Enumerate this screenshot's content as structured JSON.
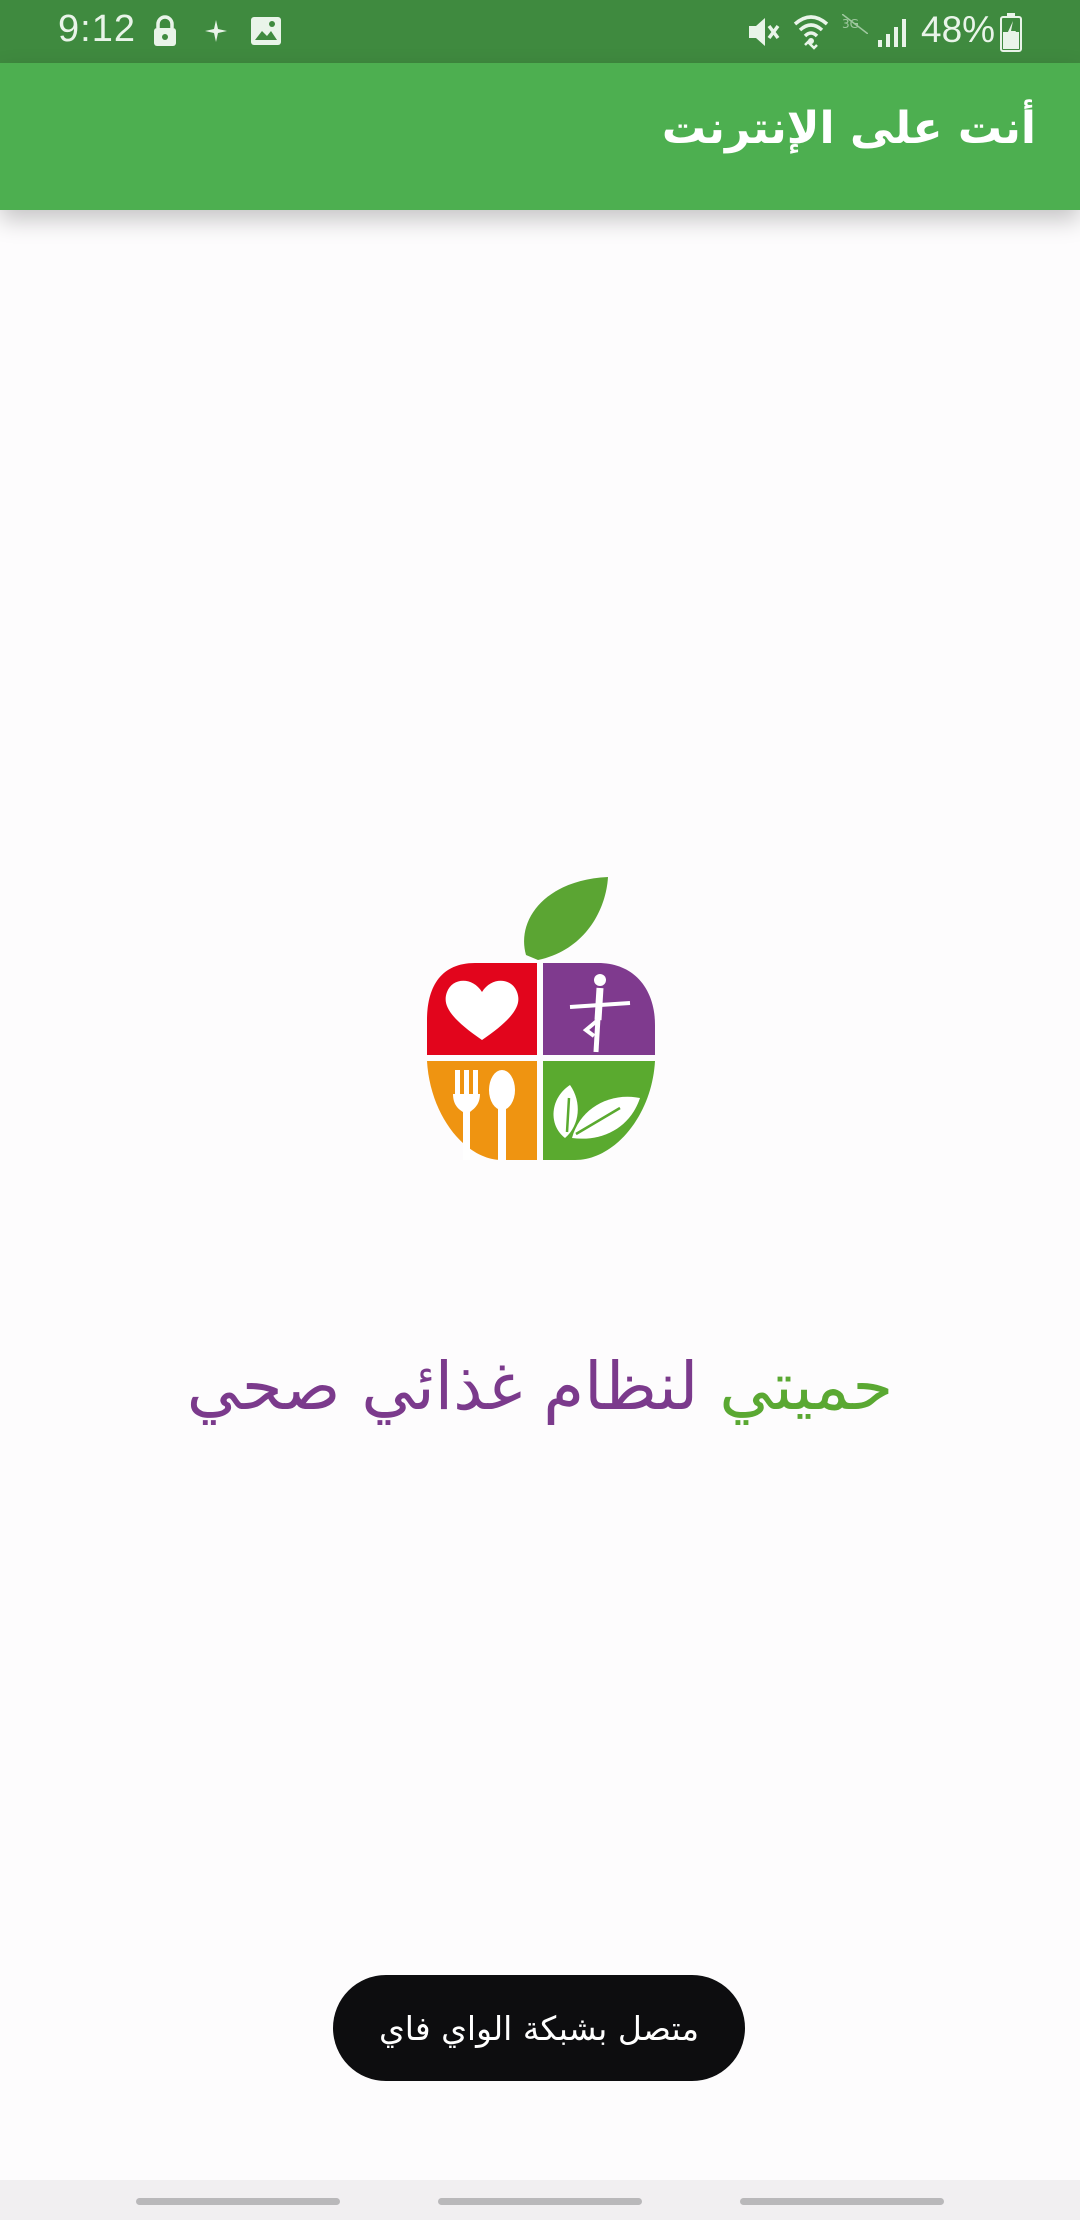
{
  "status_bar": {
    "time": "9:12",
    "battery": "48%",
    "icons": [
      "lock-icon",
      "sparkle-icon",
      "image-icon",
      "mute-icon",
      "wifi-icon",
      "signal-icon",
      "battery-icon"
    ]
  },
  "app_bar": {
    "title": "أنت على الإنترنت"
  },
  "logo": {
    "icon": "apple-logo-icon",
    "colors": {
      "leaf": "#5ba533",
      "heart_quadrant": "#e2051c",
      "figure_quadrant": "#7f3a8e",
      "cutlery_quadrant": "#ef9411",
      "leaves_quadrant": "#5aaa2f"
    }
  },
  "slogan": {
    "part1": "حميتي",
    "part2": "لنظام غذائي صحي",
    "colors": {
      "part1": "#5aa832",
      "part2": "#7b3a8c"
    }
  },
  "toast": {
    "message": "متصل بشبكة الواي فاي"
  },
  "colors": {
    "status_bar": "#3f8a3f",
    "app_bar": "#4daf50",
    "background": "#fdfcfd"
  }
}
